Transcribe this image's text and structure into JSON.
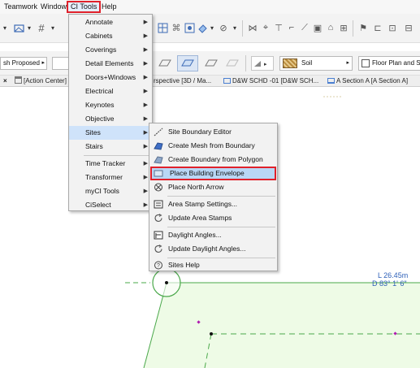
{
  "menubar": {
    "items": [
      "Teamwork",
      "Window",
      "CI Tools",
      "Help"
    ]
  },
  "toolbar": {
    "layer_field": "sh Proposed",
    "soil_label": "Soil",
    "floorplan_label": "Floor Plan and Se"
  },
  "tabs": [
    {
      "label": "[Action Center]"
    },
    {
      "label": "rspective [3D / Ma..."
    },
    {
      "label": "D&W SCHD -01 [D&W SCH..."
    },
    {
      "label": "A Section A [A Section A]"
    }
  ],
  "ci_menu": {
    "items": [
      {
        "label": "Annotate",
        "submenu": true
      },
      {
        "label": "Cabinets",
        "submenu": true
      },
      {
        "label": "Coverings",
        "submenu": true
      },
      {
        "label": "Detail Elements",
        "submenu": true
      },
      {
        "label": "Doors+Windows",
        "submenu": true
      },
      {
        "label": "Electrical",
        "submenu": true
      },
      {
        "label": "Keynotes",
        "submenu": true
      },
      {
        "label": "Objective",
        "submenu": true
      },
      {
        "label": "Sites",
        "submenu": true
      },
      {
        "label": "Stairs",
        "submenu": true
      },
      {
        "label": "Time Tracker",
        "submenu": true
      },
      {
        "label": "Transformer",
        "submenu": true
      },
      {
        "label": "myCI Tools",
        "submenu": true
      },
      {
        "label": "CiSelect",
        "submenu": true
      }
    ]
  },
  "sites_menu": {
    "items": [
      {
        "label": "Site Boundary Editor",
        "icon": "pencil-line-icon"
      },
      {
        "label": "Create Mesh from Boundary",
        "icon": "mesh-icon"
      },
      {
        "label": "Create Boundary from Polygon",
        "icon": "polygon-boundary-icon"
      },
      {
        "label": "Place Building Envelope",
        "icon": "building-envelope-icon"
      },
      {
        "label": "Place North Arrow",
        "icon": "north-arrow-icon"
      },
      {
        "label": "Area Stamp Settings...",
        "icon": "area-stamp-icon"
      },
      {
        "label": "Update Area Stamps",
        "icon": "refresh-icon"
      },
      {
        "label": "Daylight Angles...",
        "icon": "daylight-icon"
      },
      {
        "label": "Update Daylight Angles...",
        "icon": "refresh-icon"
      },
      {
        "label": "Sites Help",
        "icon": "help-icon"
      }
    ]
  },
  "canvas": {
    "dim_length": "L 26.45m",
    "dim_angle": "D 83° 1' 6\""
  },
  "colors": {
    "site_fill": "#eefbe6",
    "site_line": "#4aa84a",
    "highlight_border": "#e0212b",
    "menu_active": "#cfe3fa",
    "accent_blue": "#3d6bb6"
  }
}
